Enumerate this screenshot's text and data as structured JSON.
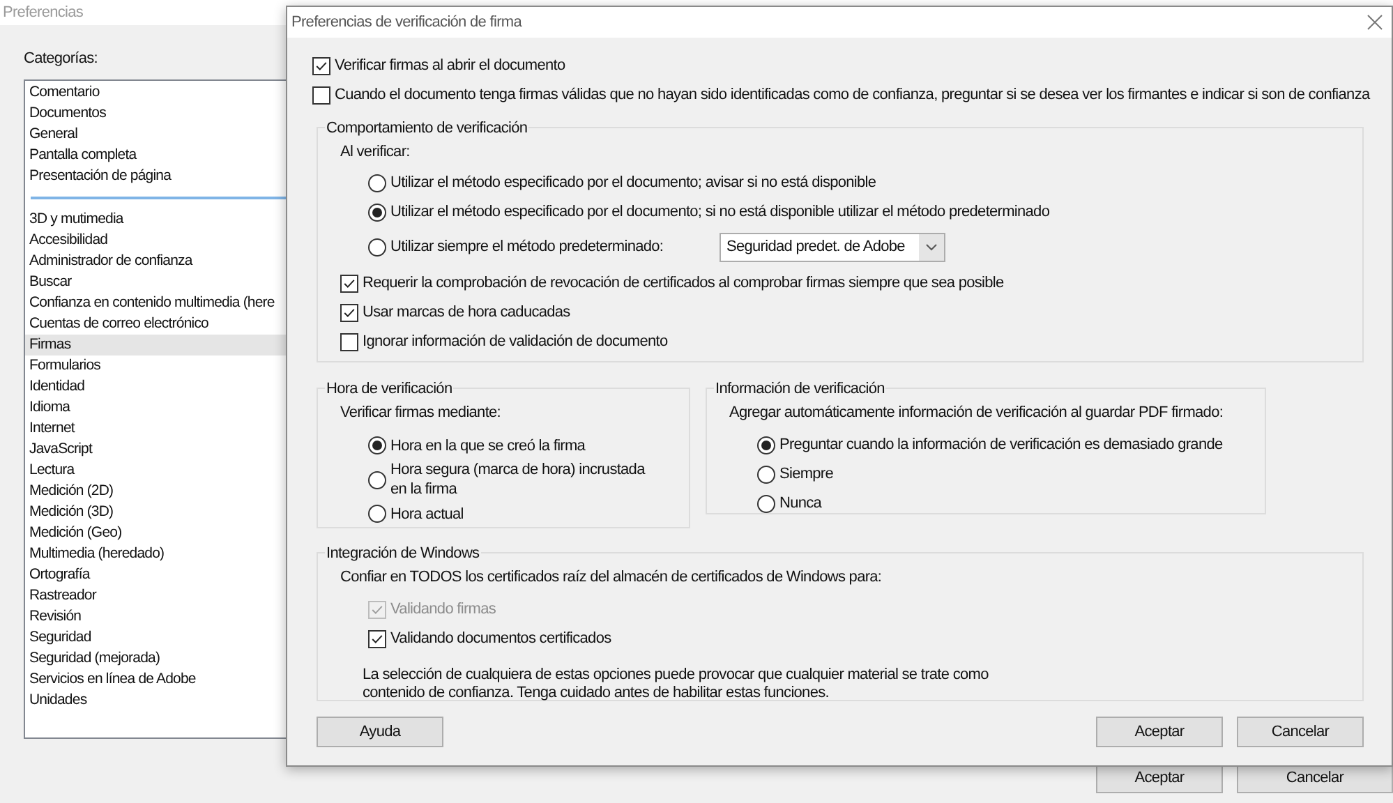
{
  "background_window": {
    "title": "Preferencias",
    "categories_label": "Categorías:",
    "category_groups": [
      [
        {
          "label": "Comentario",
          "selected": false
        },
        {
          "label": "Documentos",
          "selected": false
        },
        {
          "label": "General",
          "selected": false
        },
        {
          "label": "Pantalla completa",
          "selected": false
        },
        {
          "label": "Presentación de página",
          "selected": false
        }
      ],
      [
        {
          "label": "3D y mutimedia",
          "selected": false
        },
        {
          "label": "Accesibilidad",
          "selected": false
        },
        {
          "label": "Administrador de confianza",
          "selected": false
        },
        {
          "label": "Buscar",
          "selected": false
        },
        {
          "label": "Confianza en contenido multimedia (here",
          "selected": false
        },
        {
          "label": "Cuentas de correo electrónico",
          "selected": false
        },
        {
          "label": "Firmas",
          "selected": true
        },
        {
          "label": "Formularios",
          "selected": false
        },
        {
          "label": "Identidad",
          "selected": false
        },
        {
          "label": "Idioma",
          "selected": false
        },
        {
          "label": "Internet",
          "selected": false
        },
        {
          "label": "JavaScript",
          "selected": false
        },
        {
          "label": "Lectura",
          "selected": false
        },
        {
          "label": "Medición (2D)",
          "selected": false
        },
        {
          "label": "Medición (3D)",
          "selected": false
        },
        {
          "label": "Medición (Geo)",
          "selected": false
        },
        {
          "label": "Multimedia (heredado)",
          "selected": false
        },
        {
          "label": "Ortografía",
          "selected": false
        },
        {
          "label": "Rastreador",
          "selected": false
        },
        {
          "label": "Revisión",
          "selected": false
        },
        {
          "label": "Seguridad",
          "selected": false
        },
        {
          "label": "Seguridad (mejorada)",
          "selected": false
        },
        {
          "label": "Servicios en línea de Adobe",
          "selected": false
        },
        {
          "label": "Unidades",
          "selected": false
        }
      ]
    ],
    "buttons": [
      "Aceptar",
      "Cancelar"
    ]
  },
  "dialog": {
    "title": "Preferencias de verificación de firma",
    "options": [
      {
        "label": "Verificar firmas al abrir el documento",
        "checked": true
      },
      {
        "label": "Cuando el documento tenga firmas válidas que no hayan sido identificadas como de confianza, preguntar si se desea ver los firmantes e indicar si son de confianza",
        "checked": false
      }
    ],
    "verification_behavior": {
      "title": "Comportamiento de verificación",
      "prompt": "Al verificar:",
      "methods": [
        {
          "label": "Utilizar el método especificado por el documento; avisar si no está disponible",
          "selected": false
        },
        {
          "label": "Utilizar el método especificado por el documento; si no está disponible utilizar el método predeterminado",
          "selected": true
        },
        {
          "label": "Utilizar siempre el método predeterminado:",
          "selected": false
        }
      ],
      "default_method": {
        "value": "Seguridad predet. de Adobe"
      },
      "checks": [
        {
          "label": "Requerir la comprobación de revocación de certificados al comprobar firmas siempre que sea posible",
          "checked": true
        },
        {
          "label": "Usar marcas de hora caducadas",
          "checked": true
        },
        {
          "label": "Ignorar información de validación de documento",
          "checked": false
        }
      ]
    },
    "verification_time": {
      "title": "Hora de verificación",
      "prompt": "Verificar firmas mediante:",
      "options": [
        {
          "label": "Hora en la que se creó la firma",
          "selected": true
        },
        {
          "label": "Hora segura (marca de hora) incrustada en la firma",
          "selected": false
        },
        {
          "label": "Hora actual",
          "selected": false
        }
      ]
    },
    "verification_info": {
      "title": "Información de verificación",
      "prompt": "Agregar automáticamente información de verificación al guardar PDF firmado:",
      "options": [
        {
          "label": "Preguntar cuando la información de verificación es demasiado grande",
          "selected": true
        },
        {
          "label": "Siempre",
          "selected": false
        },
        {
          "label": "Nunca",
          "selected": false
        }
      ]
    },
    "windows_integration": {
      "title": "Integración de Windows",
      "prompt": "Confiar en TODOS los certificados raíz del almacén de certificados de Windows para:",
      "checks": [
        {
          "label": "Validando firmas",
          "checked": true,
          "disabled": true
        },
        {
          "label": "Validando documentos certificados",
          "checked": true,
          "disabled": false
        }
      ],
      "note": [
        "La selección de cualquiera de estas opciones puede provocar que cualquier material se trate como",
        "contenido de confianza. Tenga cuidado antes de habilitar estas funciones."
      ]
    },
    "help_button": "Ayuda",
    "buttons": [
      "Aceptar",
      "Cancelar"
    ]
  }
}
